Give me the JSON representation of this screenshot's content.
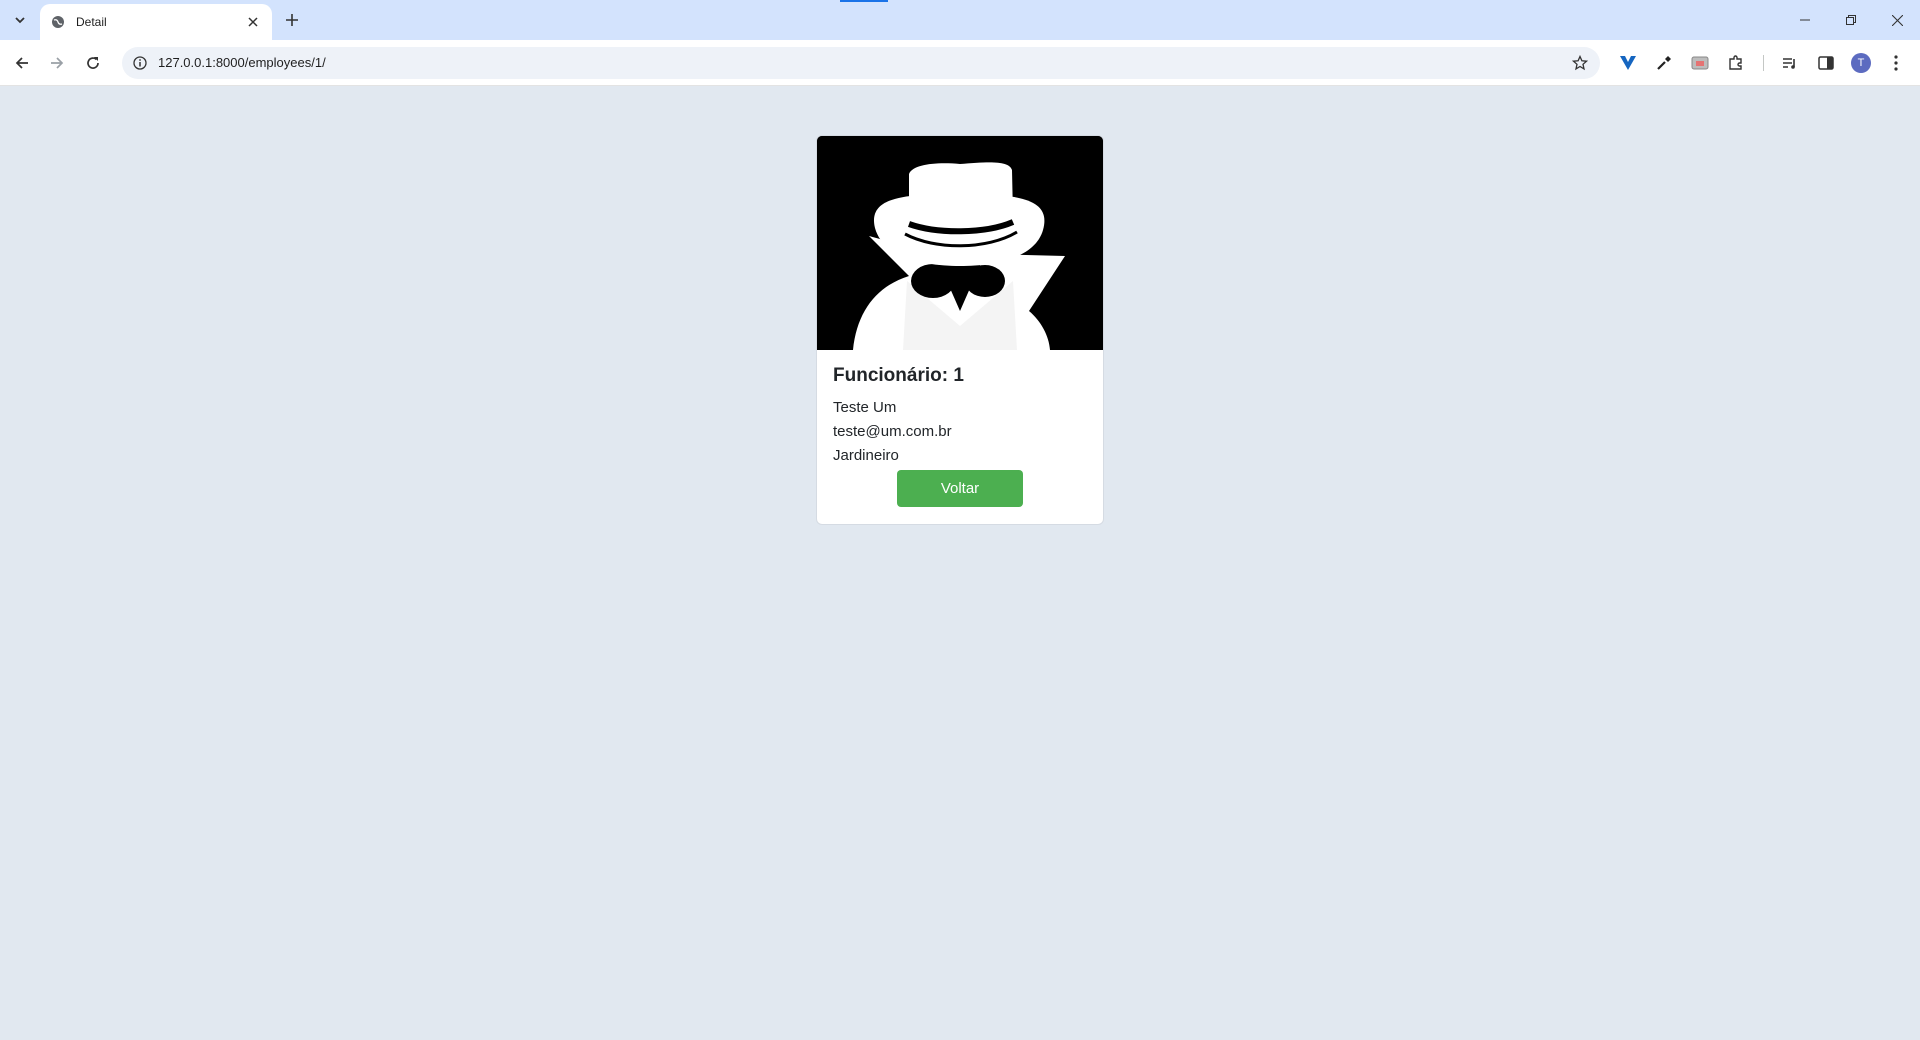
{
  "browser": {
    "tab_title": "Detail",
    "url": "127.0.0.1:8000/employees/1/",
    "profile_initial": "T",
    "icons": {
      "tab_search": "chevron-down-icon",
      "favicon": "globe-icon",
      "close": "close-icon",
      "new_tab": "plus-icon",
      "back": "arrow-left-icon",
      "forward": "arrow-right-icon",
      "reload": "reload-icon",
      "site_info": "info-icon",
      "bookmark": "star-icon",
      "menu": "more-vertical-icon"
    },
    "accent_color": "#1a73e8"
  },
  "employee": {
    "title": "Funcionário: 1",
    "name": "Teste Um",
    "email": "teste@um.com.br",
    "role": "Jardineiro",
    "image_icon": "incognito-spy-icon"
  },
  "actions": {
    "back_label": "Voltar",
    "back_color": "#4caf50"
  }
}
